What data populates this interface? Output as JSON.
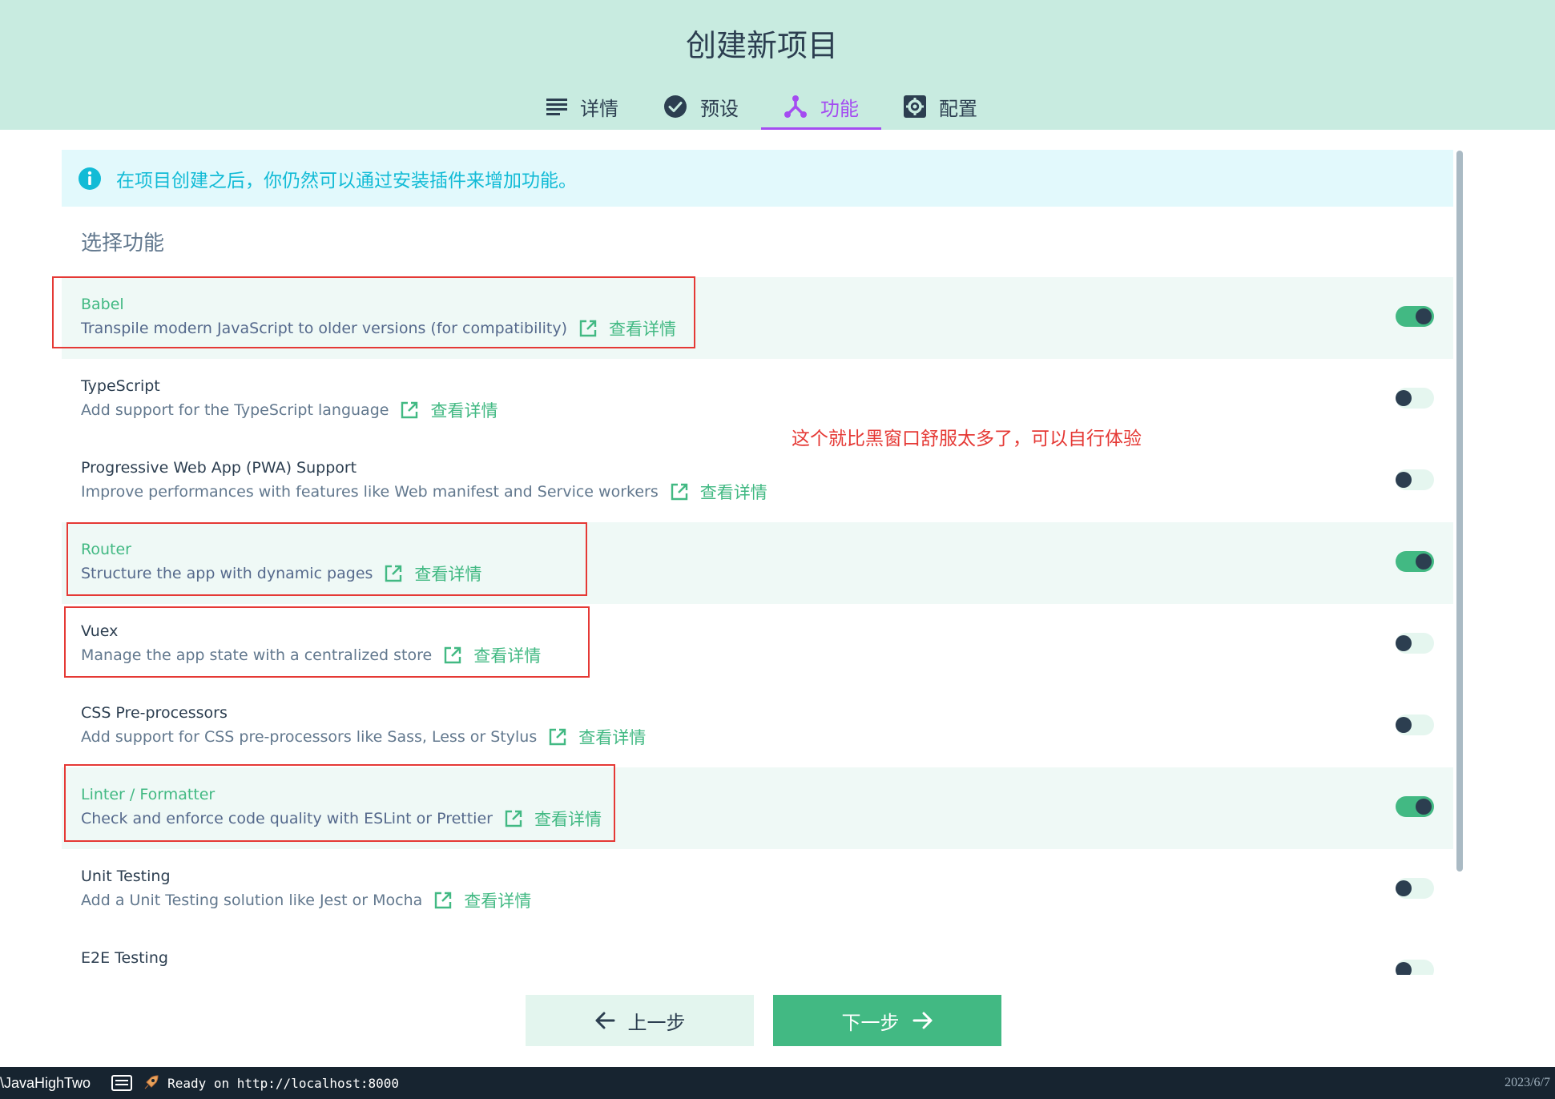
{
  "header": {
    "title": "创建新项目",
    "tabs": [
      {
        "label": "详情",
        "icon": "list-icon",
        "active": false
      },
      {
        "label": "预设",
        "icon": "check-circle-icon",
        "active": false
      },
      {
        "label": "功能",
        "icon": "branch-icon",
        "active": true
      },
      {
        "label": "配置",
        "icon": "gear-icon",
        "active": false
      }
    ]
  },
  "info": {
    "icon": "info-icon",
    "text": "在项目创建之后，你仍然可以通过安装插件来增加功能。"
  },
  "section_title": "选择功能",
  "features": [
    {
      "name": "Babel",
      "description": "Transpile modern JavaScript to older versions (for compatibility)",
      "link": "查看详情",
      "enabled": true
    },
    {
      "name": "TypeScript",
      "description": "Add support for the TypeScript language",
      "link": "查看详情",
      "enabled": false
    },
    {
      "name": "Progressive Web App (PWA) Support",
      "description": "Improve performances with features like Web manifest and Service workers",
      "link": "查看详情",
      "enabled": false
    },
    {
      "name": "Router",
      "description": "Structure the app with dynamic pages",
      "link": "查看详情",
      "enabled": true
    },
    {
      "name": "Vuex",
      "description": "Manage the app state with a centralized store",
      "link": "查看详情",
      "enabled": false
    },
    {
      "name": "CSS Pre-processors",
      "description": "Add support for CSS pre-processors like Sass, Less or Stylus",
      "link": "查看详情",
      "enabled": false
    },
    {
      "name": "Linter / Formatter",
      "description": "Check and enforce code quality with ESLint or Prettier",
      "link": "查看详情",
      "enabled": true
    },
    {
      "name": "Unit Testing",
      "description": "Add a Unit Testing solution like Jest or Mocha",
      "link": "查看详情",
      "enabled": false
    },
    {
      "name": "E2E Testing",
      "description": "",
      "link": "",
      "enabled": false
    }
  ],
  "annotation": "这个就比黑窗口舒服太多了，可以自行体验",
  "buttons": {
    "prev": "上一步",
    "next": "下一步"
  },
  "taskbar": {
    "path": "\\JavaHighTwo",
    "status": "Ready on http://localhost:8000",
    "time": "2023/6/7"
  },
  "colors": {
    "header_bg": "#c8ebe0",
    "accent_green": "#42b983",
    "accent_purple": "#a44cf1",
    "info_cyan": "#12bbd6",
    "annotation_red": "#e53935"
  }
}
